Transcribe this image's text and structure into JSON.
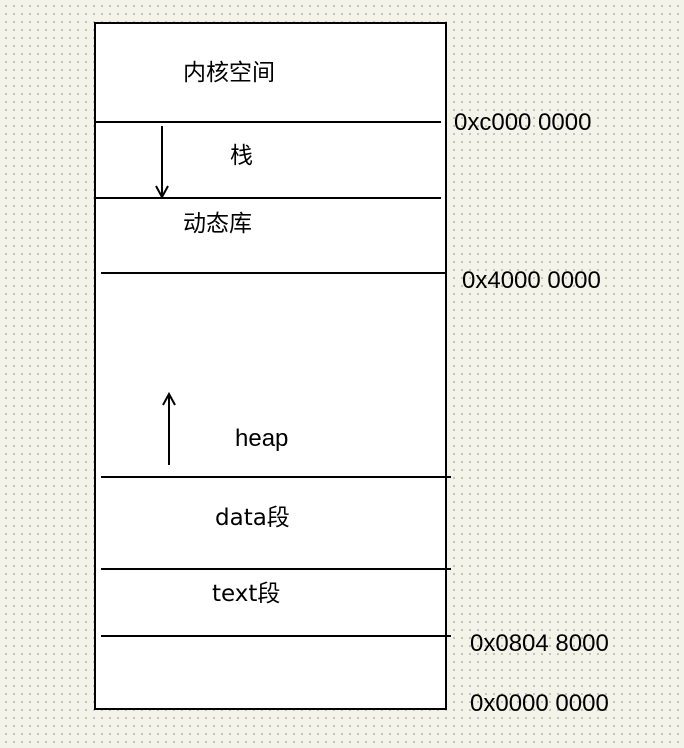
{
  "diagram": {
    "segments": {
      "kernel_space": "内核空间",
      "stack": "栈",
      "shared_libs": "动态库",
      "heap": "heap",
      "data_segment": "data段",
      "text_segment": "text段"
    },
    "addresses": {
      "kernel_start": "0xc000 0000",
      "mmap_base": "0x4000 0000",
      "text_start": "0x0804 8000",
      "zero": "0x0000 0000"
    },
    "growth": {
      "stack": "down",
      "heap": "up"
    }
  }
}
